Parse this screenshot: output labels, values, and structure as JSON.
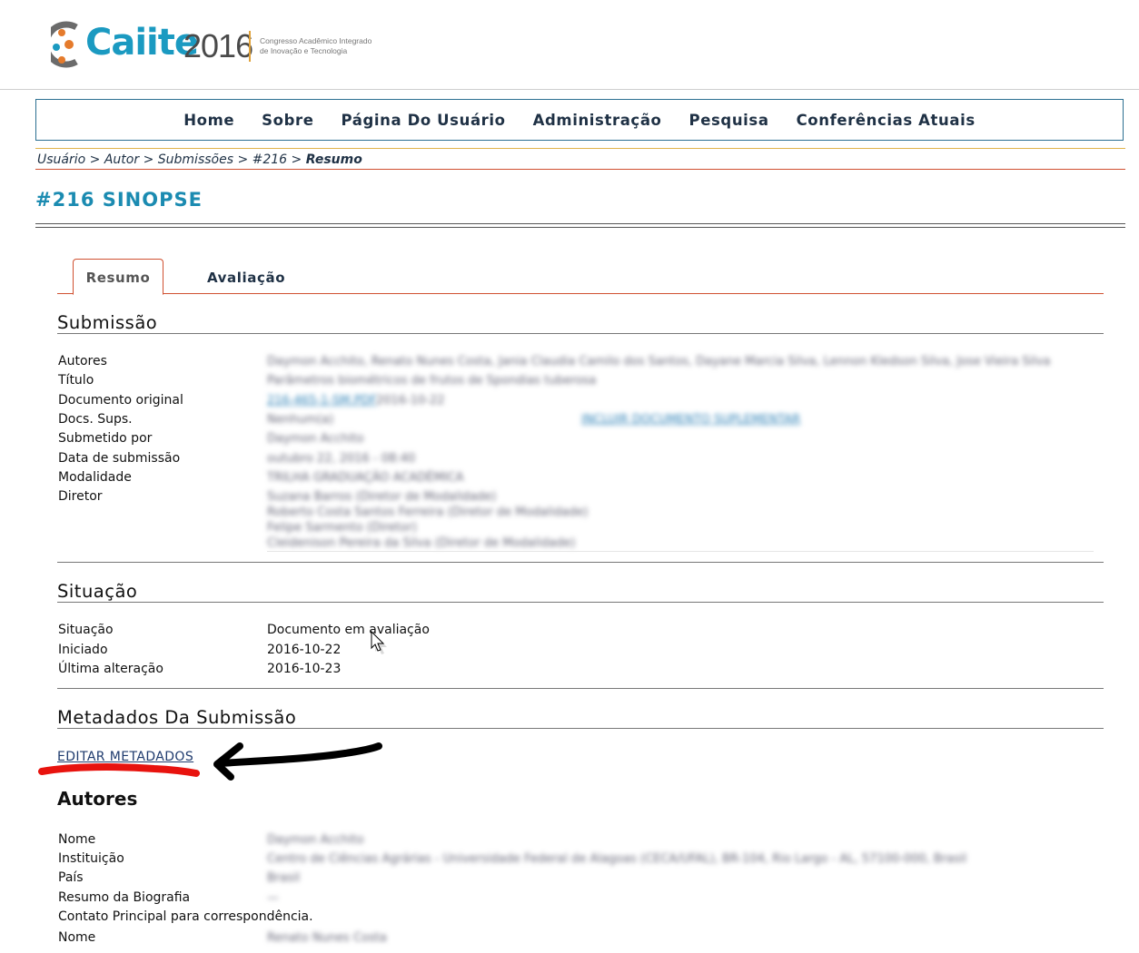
{
  "brand": {
    "name": "Caiite",
    "year": "2016",
    "tagline_line1": "Congresso Acadêmico Integrado",
    "tagline_line2": "de Inovação e Tecnologia",
    "accent_color": "#1b9ac1"
  },
  "nav": {
    "items": [
      "Home",
      "Sobre",
      "Página Do Usuário",
      "Administração",
      "Pesquisa",
      "Conferências Atuais"
    ]
  },
  "breadcrumb": {
    "items": [
      "Usuário",
      "Autor",
      "Submissões",
      "#216"
    ],
    "separator": ">",
    "current": "Resumo"
  },
  "page_title": "#216 SINOPSE",
  "tabs": {
    "active": "Resumo",
    "other": "Avaliação"
  },
  "submissao": {
    "heading": "Submissão",
    "labels": [
      "Autores",
      "Título",
      "Documento original",
      "Docs. Sups.",
      "Submetido por",
      "Data de submissão",
      "Modalidade",
      "Diretor"
    ],
    "values": [
      "Daymon Acchito, Renato Nunes Costa, Jania Claudia Camilo dos Santos, Dayane Marcia Silva, Lennon Kledson Silva, Jose Vieira Silva",
      "Parâmetros biométricos de frutos de Spondias tuberosa",
      "216-465-1-SM.PDF",
      "Nenhum(a)",
      "Daymon Acchito",
      "outubro 22, 2016 - 08:40",
      "TRILHA GRADUAÇÃO ACADÊMICA"
    ],
    "doc_date": "2016-10-22",
    "add_supp_link": "INCLUIR DOCUMENTO SUPLEMENTAR",
    "directors": [
      "Suzana Barros (Diretor de Modalidade)",
      "Roberto Costa Santos Ferreira (Diretor de Modalidade)",
      "Felipe Sarmento (Diretor)",
      "Cleidenison Pereira da Silva (Diretor de Modalidade)"
    ]
  },
  "situacao": {
    "heading": "Situação",
    "rows": [
      {
        "label": "Situação",
        "value": "Documento em avaliação"
      },
      {
        "label": "Iniciado",
        "value": "2016-10-22"
      },
      {
        "label": "Última alteração",
        "value": "2016-10-23"
      }
    ]
  },
  "metadados": {
    "heading": "Metadados Da Submissão",
    "edit_link": "EDITAR METADADOS"
  },
  "autores": {
    "heading": "Autores",
    "labels": [
      "Nome",
      "Instituição",
      "País",
      "Resumo da Biografia",
      "Contato Principal para correspondência.",
      "Nome"
    ],
    "values": [
      "Daymon Acchito",
      "Centro de Ciências Agrárias - Universidade Federal de Alagoas (CECA/UFAL), BR-104, Rio Largo - AL, 57100-000, Brasil",
      "Brasil",
      "—",
      "",
      "Renato Nunes Costa"
    ]
  },
  "annotations": {
    "underline_color": "#e8130e",
    "arrow_color": "#000000"
  }
}
